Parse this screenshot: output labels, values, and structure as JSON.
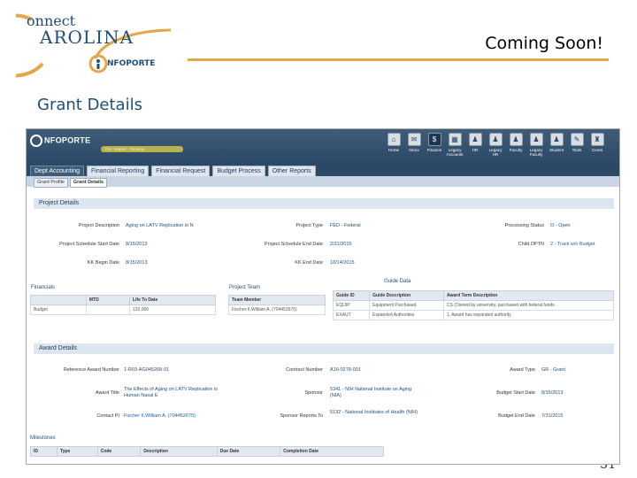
{
  "logo": {
    "line1": "onnect",
    "line2": "AROLINA",
    "sub": "NFOPORTE"
  },
  "slide": {
    "title": "Coming Soon!",
    "subtitle": "Grant Details",
    "page": "51"
  },
  "app": {
    "logo_text": "NFOPORTE",
    "breadcrumb": "Fin · Report · Develop",
    "modules": [
      {
        "label": "Home",
        "icon": "⌂"
      },
      {
        "label": "Inbox",
        "icon": "✉"
      },
      {
        "label": "Finance",
        "icon": "$"
      },
      {
        "label": "Legacy Accounts",
        "icon": "▦"
      },
      {
        "label": "HR",
        "icon": "♟"
      },
      {
        "label": "Legacy HR",
        "icon": "♟"
      },
      {
        "label": "Faculty",
        "icon": "♟"
      },
      {
        "label": "Legacy Faculty",
        "icon": "♟"
      },
      {
        "label": "Student",
        "icon": "♟"
      },
      {
        "label": "Tools",
        "icon": "✎"
      },
      {
        "label": "Cores",
        "icon": "♜"
      }
    ],
    "tabs": [
      "Dept Accounting",
      "Financial Reporting",
      "Financial Request",
      "Budget Process",
      "Other Reports"
    ],
    "subtabs": [
      "Grant Profile",
      "Grant Details"
    ]
  },
  "project": {
    "section": "Project Details",
    "fields": [
      {
        "label": "Project Description",
        "value": "Aging on LATV Replication in N"
      },
      {
        "label": "Project Type",
        "value": "FED - Federal"
      },
      {
        "label": "Processing Status",
        "value": "O - Open"
      },
      {
        "label": "Project Schedule Start Date",
        "value": "8/15/2013"
      },
      {
        "label": "Project Schedule End Date",
        "value": "2/31/2015"
      },
      {
        "label": "Child OPTN",
        "value": "2 - Track w/o Budget"
      },
      {
        "label": "KK Begin Date",
        "value": "8/15/2013"
      },
      {
        "label": "KK End Date",
        "value": "10/14/2015"
      }
    ]
  },
  "financials": {
    "title": "Financials",
    "headers": [
      "",
      "MTD",
      "Life To Date"
    ],
    "rows": [
      [
        "Budget",
        "",
        "132,000"
      ]
    ]
  },
  "project_team": {
    "title": "Project Team",
    "headers": [
      "Team Member"
    ],
    "rows": [
      [
        "Fischer II,William A. (704452675)"
      ]
    ]
  },
  "guide_data": {
    "title": "Guide Data",
    "headers": [
      "Guide ID",
      "Guide Description",
      "Award Term Description"
    ],
    "rows": [
      [
        "EQUIP",
        "Equipment Purchased",
        "CS (Owned by university; purchased with federal funds"
      ],
      [
        "EXAUT",
        "Expanded Authorities",
        "1. Award has expanded authority"
      ]
    ]
  },
  "award": {
    "section": "Award Details",
    "fields": [
      {
        "label": "Reference Award Number",
        "value": "1-R03-AG045268-01"
      },
      {
        "label": "Contract Number",
        "value": "A16-0278-001"
      },
      {
        "label": "Award Type",
        "value": "GR - Grant"
      },
      {
        "label": "Award Title",
        "value": "The Effects of Aging on LATV Replication in Human Nasal E"
      },
      {
        "label": "Sponsor",
        "value": "5341 - NIH National Institute on Aging (NIA)"
      },
      {
        "label": "Budget Start Date",
        "value": "8/15/2013"
      },
      {
        "label": "Contact PI",
        "value": "Fischer II,William A. (704452675)"
      },
      {
        "label": "Sponsor Reports To",
        "value": "5132 - National Institutes of Health (NIH)"
      },
      {
        "label": "Budget End Date",
        "value": "7/31/2015"
      }
    ]
  },
  "milestones": {
    "title": "Milestones",
    "headers": [
      "ID",
      "Type",
      "Code",
      "Description",
      "Due Date",
      "Completion Date"
    ]
  },
  "colors": {
    "accent": "#e3a64a",
    "header": "#2b4966",
    "title": "#1f4e79"
  }
}
